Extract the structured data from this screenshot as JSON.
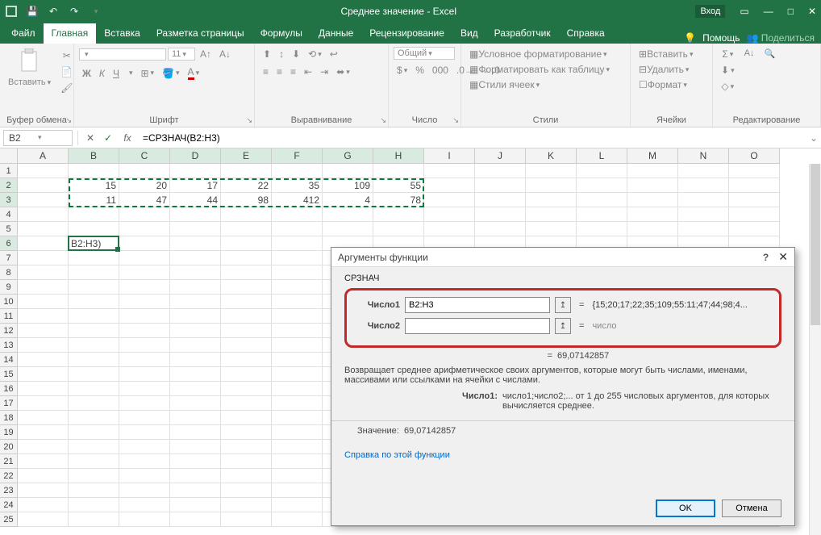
{
  "titlebar": {
    "title": "Среднее значение - Excel",
    "login": "Вход"
  },
  "tabs": [
    "Файл",
    "Главная",
    "Вставка",
    "Разметка страницы",
    "Формулы",
    "Данные",
    "Рецензирование",
    "Вид",
    "Разработчик",
    "Справка"
  ],
  "tabs_active_index": 1,
  "tabs_right": {
    "help": "Помощь",
    "share": "Поделиться"
  },
  "ribbon_groups": {
    "clipboard": {
      "label": "Буфер обмена",
      "paste": "Вставить"
    },
    "font": {
      "label": "Шрифт",
      "font_value": "",
      "size_value": "11"
    },
    "alignment": {
      "label": "Выравнивание"
    },
    "number": {
      "label": "Число",
      "format_value": "Общий"
    },
    "styles": {
      "label": "Стили",
      "cond": "Условное форматирование",
      "table": "Форматировать как таблицу",
      "cell": "Стили ячеек"
    },
    "cells": {
      "label": "Ячейки",
      "insert": "Вставить",
      "delete": "Удалить",
      "format": "Формат"
    },
    "editing": {
      "label": "Редактирование"
    }
  },
  "formula_bar": {
    "namebox": "B2",
    "formula": "=СРЗНАЧ(B2:H3)"
  },
  "grid": {
    "columns": [
      "A",
      "B",
      "C",
      "D",
      "E",
      "F",
      "G",
      "H",
      "I",
      "J",
      "K",
      "L",
      "M",
      "N",
      "O"
    ],
    "row_count": 25,
    "data": {
      "r2": {
        "B": 15,
        "C": 20,
        "D": 17,
        "E": 22,
        "F": 35,
        "G": 109,
        "H": 55
      },
      "r3": {
        "B": 11,
        "C": 47,
        "D": 44,
        "E": 98,
        "F": 412,
        "G": 4,
        "H": 78
      }
    },
    "editing_cell": {
      "row": 6,
      "col": "B",
      "display": "B2:H3)"
    },
    "active_cell": "B6",
    "marquee_range": "B2:H3"
  },
  "dialog": {
    "title": "Аргументы функции",
    "function_name": "СРЗНАЧ",
    "args": [
      {
        "label": "Число1",
        "value": "B2:H3",
        "result": "{15;20;17;22;35;109;55:11;47;44;98;4..."
      },
      {
        "label": "Число2",
        "value": "",
        "result": "число",
        "gray": true
      }
    ],
    "calc_result": "69,07142857",
    "description": "Возвращает среднее арифметическое своих аргументов, которые могут быть числами, именами, массивами или ссылками на ячейки с числами.",
    "arg_desc_key": "Число1:",
    "arg_desc_val": "число1;число2;... от 1 до 255 числовых аргументов, для которых вычисляется среднее.",
    "value_label": "Значение:",
    "value": "69,07142857",
    "help_link": "Справка по этой функции",
    "ok": "OK",
    "cancel": "Отмена"
  }
}
